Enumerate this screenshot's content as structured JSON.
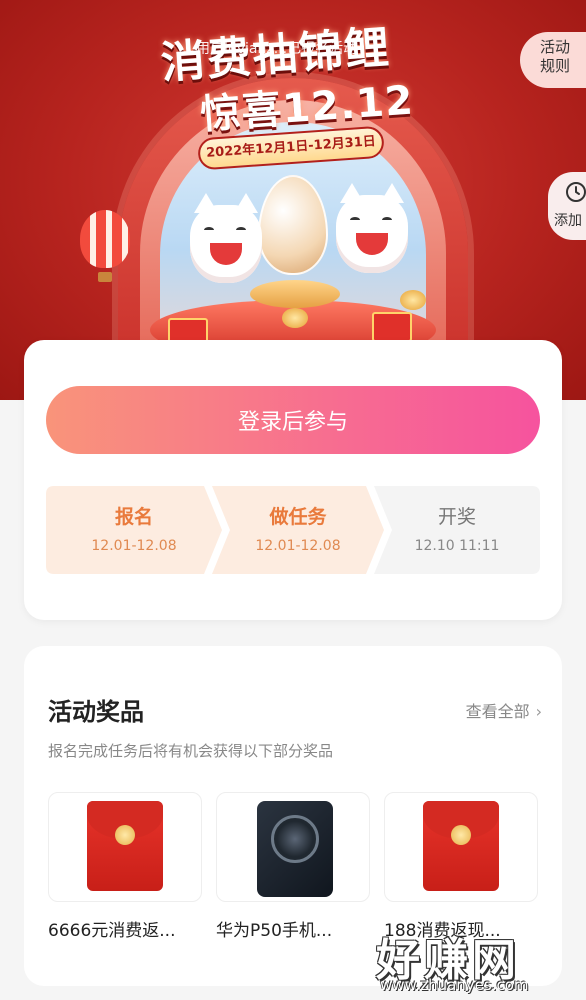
{
  "hero": {
    "title_main": "消费抽锦鲤",
    "title_sub": "惊喜12.12",
    "date_range": "2022年12月1日-12月31日",
    "user_note": "用户luvianz...已报名活动",
    "rules_label_line1": "活动",
    "rules_label_line2": "规则",
    "add_label": "添加"
  },
  "join": {
    "button_label": "登录后参与",
    "steps": [
      {
        "label": "报名",
        "date": "12.01-12.08"
      },
      {
        "label": "做任务",
        "date": "12.01-12.08"
      },
      {
        "label": "开奖",
        "date": "12.10 11:11"
      }
    ]
  },
  "prizes": {
    "title": "活动奖品",
    "view_all": "查看全部",
    "subtitle": "报名完成任务后将有机会获得以下部分奖品",
    "items": [
      {
        "name": "6666元消费返..."
      },
      {
        "name": "华为P50手机..."
      },
      {
        "name": "188消费返现..."
      }
    ]
  },
  "watermark": {
    "text": "好赚网",
    "site": "www.zhuanyes.com"
  },
  "colors": {
    "brand_red": "#b7241f",
    "button_gradient_start": "#f9947a",
    "button_gradient_end": "#f6539e",
    "step_active": "#e97a3c"
  }
}
